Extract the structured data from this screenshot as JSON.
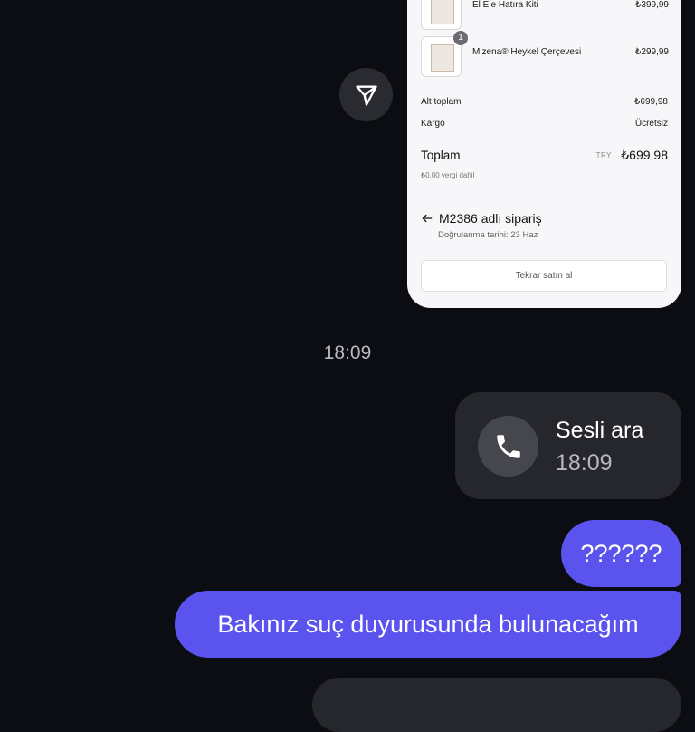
{
  "order": {
    "items": [
      {
        "name": "El Ele Hatıra Kiti",
        "price": "₺399,99",
        "qty": ""
      },
      {
        "name": "Mizena® Heykel Çerçevesi",
        "price": "₺299,99",
        "qty": "1"
      }
    ],
    "subtotal_label": "Alt toplam",
    "subtotal_value": "₺699,98",
    "shipping_label": "Kargo",
    "shipping_value": "Ücretsiz",
    "total_label": "Toplam",
    "total_currency": "TRY",
    "total_value": "₺699,98",
    "tax_note": "₺0,00 vergi dahil",
    "order_title": "M2386 adlı sipariş",
    "order_confirmed": "Doğrulanma tarihi: 23 Haz",
    "rebuy_label": "Tekrar satın al"
  },
  "chat": {
    "timestamp": "18:09",
    "call": {
      "title": "Sesli ara",
      "time": "18:09"
    },
    "messages": [
      {
        "text": "??????"
      },
      {
        "text": "Bakınız suç duyurusunda bulunacağım"
      }
    ]
  },
  "colors": {
    "background": "#0c0d12",
    "bubble_sent": "#5a53ee",
    "bubble_received": "#26272d"
  },
  "icons": {
    "share": "paper-plane-icon",
    "call": "phone-icon",
    "back": "arrow-left-icon"
  }
}
